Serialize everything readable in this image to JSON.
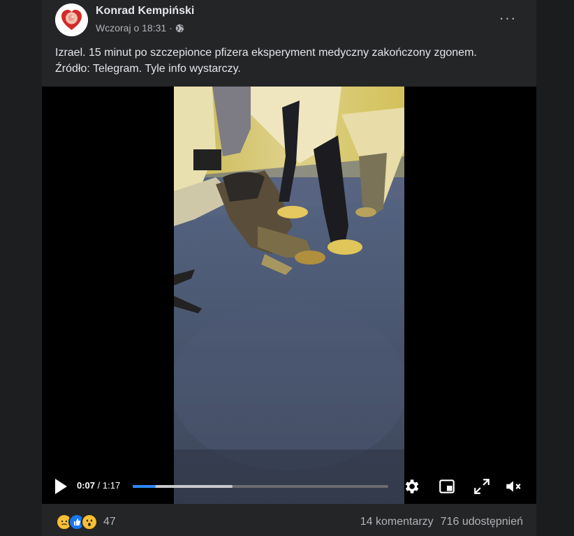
{
  "post": {
    "author": "Konrad Kempiński",
    "timestamp": "Wczoraj o 18:31",
    "separator": "·",
    "privacy_icon": "globe-icon",
    "more_icon": "more-dots-icon",
    "more_label": "···",
    "text_line1": "Izrael. 15 minut po szczepionce pfizera eksperyment medyczny zakończony zgonem.",
    "text_line2": "Źródło: Telegram. Tyle info wystarczy."
  },
  "video": {
    "current_time": "0:07",
    "time_separator": " / ",
    "duration": "1:17",
    "progress_fraction": 0.09,
    "buffered_fraction": 0.39,
    "accent_color": "#2d88ff",
    "icons": [
      "play-icon",
      "settings-gear-icon",
      "picture-in-picture-icon",
      "fullscreen-icon",
      "volume-muted-icon"
    ]
  },
  "footer": {
    "reaction_icons": [
      "sad-reaction-icon",
      "like-reaction-icon",
      "wow-reaction-icon"
    ],
    "reaction_count": "47",
    "comments": "14 komentarzy",
    "shares": "716 udostępnień"
  }
}
